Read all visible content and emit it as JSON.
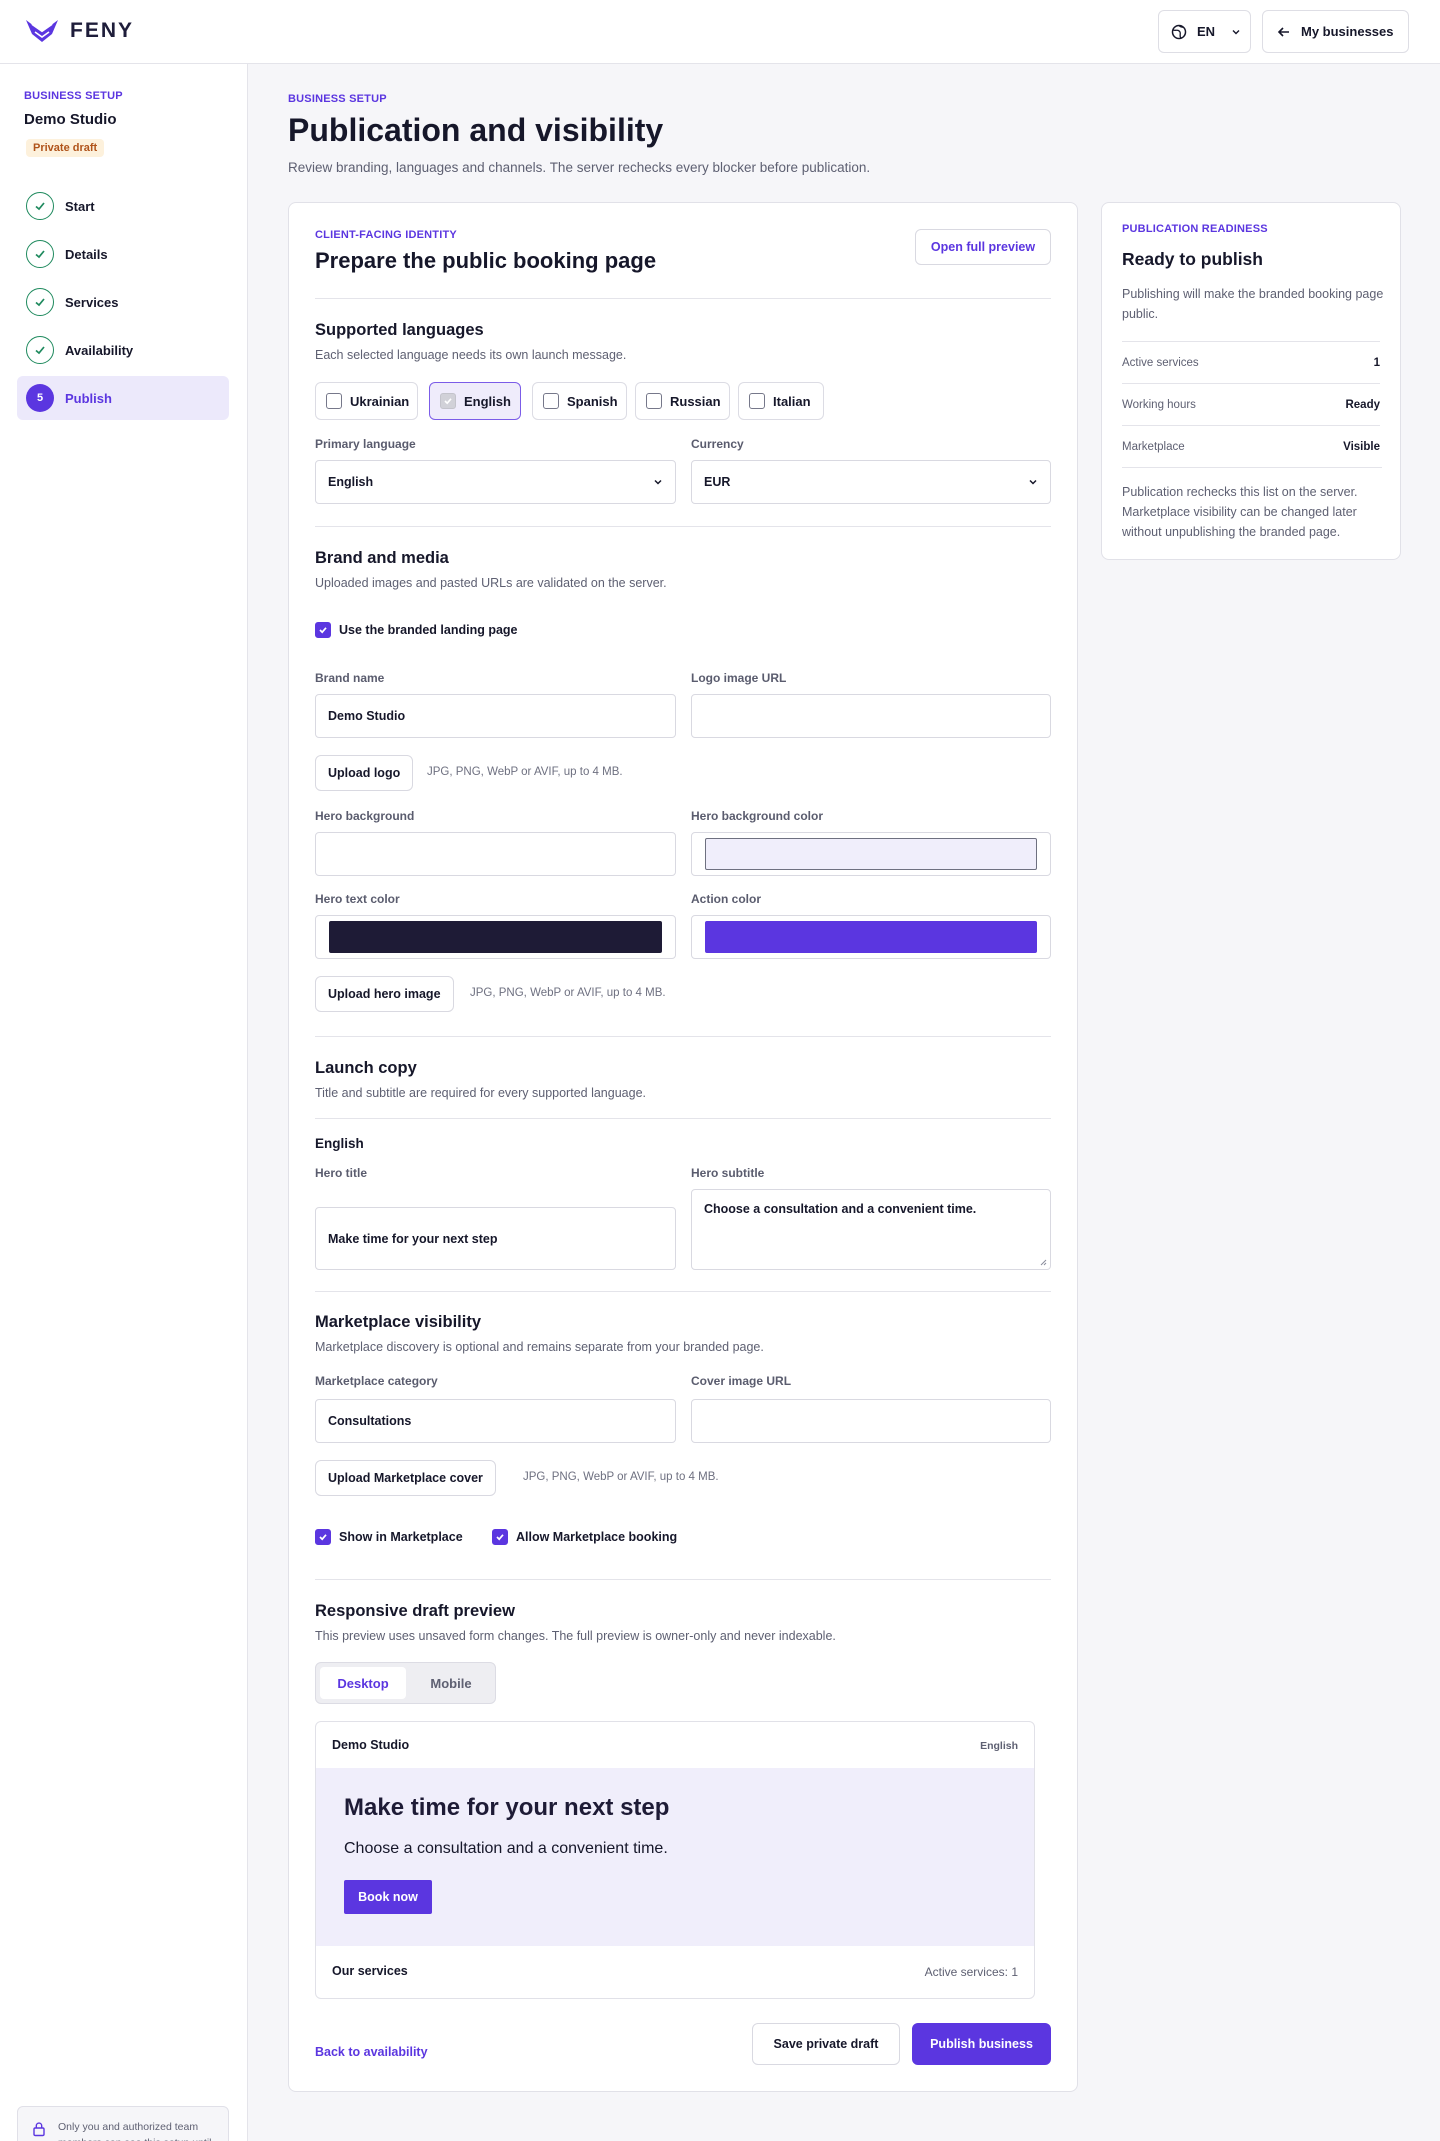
{
  "header": {
    "brand": "FENY",
    "language_code": "EN",
    "my_businesses": "My businesses"
  },
  "sidebar": {
    "eyebrow": "BUSINESS SETUP",
    "business_name": "Demo Studio",
    "status_badge": "Private draft",
    "steps": [
      {
        "label": "Start",
        "state": "done"
      },
      {
        "label": "Details",
        "state": "done"
      },
      {
        "label": "Services",
        "state": "done"
      },
      {
        "label": "Availability",
        "state": "done"
      },
      {
        "label": "Publish",
        "state": "active",
        "number": "5"
      }
    ],
    "privacy_note": "Only you and authorized team members can see this setup until publication."
  },
  "page": {
    "eyebrow": "BUSINESS SETUP",
    "title": "Publication and visibility",
    "subtitle": "Review branding, languages and channels. The server rechecks every blocker before publication."
  },
  "identity": {
    "eyebrow": "CLIENT-FACING IDENTITY",
    "title": "Prepare the public booking page",
    "open_preview": "Open full preview"
  },
  "languages": {
    "title": "Supported languages",
    "description": "Each selected language needs its own launch message.",
    "options": [
      {
        "label": "Ukrainian",
        "checked": false
      },
      {
        "label": "English",
        "checked": true
      },
      {
        "label": "Spanish",
        "checked": false
      },
      {
        "label": "Russian",
        "checked": false
      },
      {
        "label": "Italian",
        "checked": false
      }
    ],
    "primary_label": "Primary language",
    "primary_value": "English",
    "currency_label": "Currency",
    "currency_value": "EUR"
  },
  "brand": {
    "title": "Brand and media",
    "description": "Uploaded images and pasted URLs are validated on the server.",
    "use_branded_label": "Use the branded landing page",
    "use_branded_checked": true,
    "brand_name_label": "Brand name",
    "brand_name_value": "Demo Studio",
    "logo_url_label": "Logo image URL",
    "logo_url_value": "",
    "upload_logo": "Upload logo",
    "upload_hint": "JPG, PNG, WebP or AVIF, up to 4 MB.",
    "hero_bg_label": "Hero background",
    "hero_bg_value": "",
    "hero_bg_color_label": "Hero background color",
    "hero_text_color_label": "Hero text color",
    "action_color_label": "Action color",
    "upload_hero": "Upload hero image",
    "colors": {
      "hero_background": "#f0eefb",
      "hero_text": "#1e1b36",
      "action": "#5b36e0"
    }
  },
  "launch": {
    "title": "Launch copy",
    "description": "Title and subtitle are required for every supported language.",
    "language": "English",
    "hero_title_label": "Hero title",
    "hero_title_value": "Make time for your next step",
    "hero_subtitle_label": "Hero subtitle",
    "hero_subtitle_value": "Choose a consultation and a convenient time."
  },
  "marketplace": {
    "title": "Marketplace visibility",
    "description": "Marketplace discovery is optional and remains separate from your branded page.",
    "category_label": "Marketplace category",
    "category_value": "Consultations",
    "cover_url_label": "Cover image URL",
    "cover_url_value": "",
    "upload_cover": "Upload Marketplace cover",
    "upload_hint": "JPG, PNG, WebP or AVIF, up to 4 MB.",
    "show_label": "Show in Marketplace",
    "show_checked": true,
    "allow_label": "Allow Marketplace booking",
    "allow_checked": true
  },
  "preview": {
    "title": "Responsive draft preview",
    "description": "This preview uses unsaved form changes. The full preview is owner-only and never indexable.",
    "tabs": [
      {
        "label": "Desktop",
        "active": true
      },
      {
        "label": "Mobile",
        "active": false
      }
    ],
    "brand": "Demo Studio",
    "language": "English",
    "hero_title": "Make time for your next step",
    "hero_subtitle": "Choose a consultation and a convenient time.",
    "book_now": "Book now",
    "services_heading": "Our services",
    "services_count": "Active services: 1"
  },
  "footer": {
    "back": "Back to availability",
    "save": "Save private draft",
    "publish": "Publish business"
  },
  "readiness": {
    "eyebrow": "PUBLICATION READINESS",
    "title": "Ready to publish",
    "description": "Publishing will make the branded booking page public.",
    "rows": [
      {
        "label": "Active services",
        "value": "1"
      },
      {
        "label": "Working hours",
        "value": "Ready"
      },
      {
        "label": "Marketplace",
        "value": "Visible"
      }
    ],
    "note": "Publication rechecks this list on the server. Marketplace visibility can be changed later without unpublishing the branded page."
  },
  "icons": {
    "logo": "feny-wing-logo-icon",
    "globe": "globe-icon",
    "chevron": "chevron-down-icon",
    "back_arrow": "arrow-left-icon",
    "check": "check-icon",
    "lock": "lock-icon"
  },
  "theme": {
    "accent": "#5b36e0",
    "success": "#1f8a5e",
    "badge_bg": "#fdf1dc",
    "badge_text": "#b0531a"
  }
}
